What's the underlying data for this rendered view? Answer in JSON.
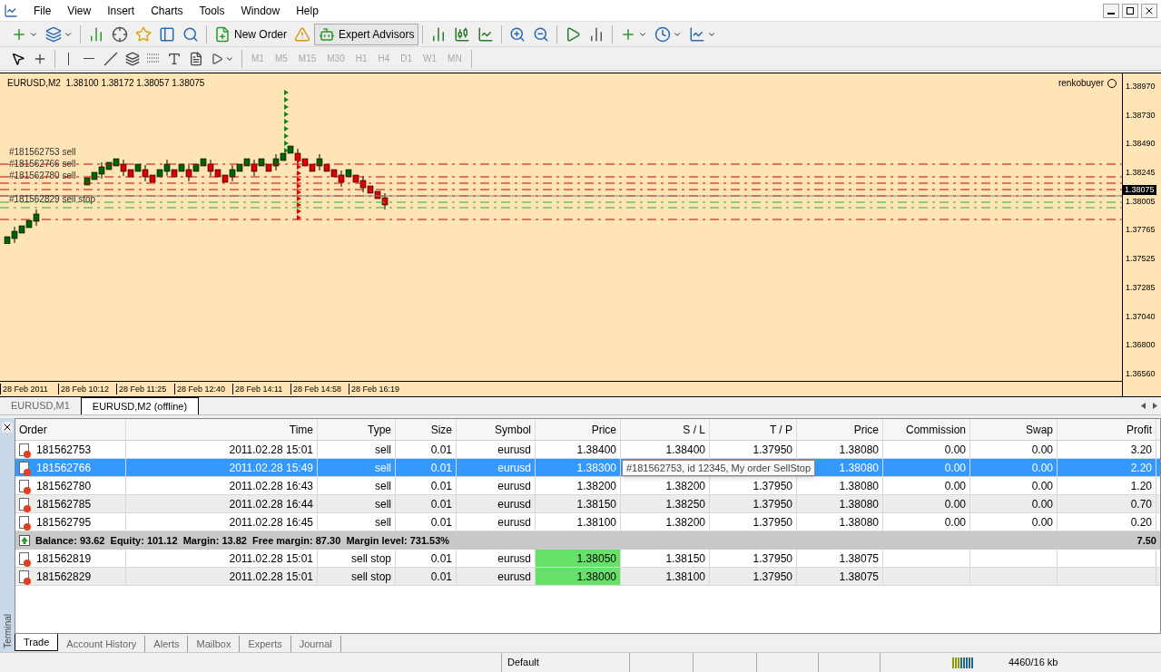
{
  "menu": [
    "File",
    "View",
    "Insert",
    "Charts",
    "Tools",
    "Window",
    "Help"
  ],
  "toolbar": {
    "new_order": "New Order",
    "expert_advisors": "Expert Advisors",
    "experts_on": true
  },
  "timeframes": [
    {
      "label": "M1",
      "disabled": true
    },
    {
      "label": "M5",
      "disabled": true
    },
    {
      "label": "M15",
      "disabled": true
    },
    {
      "label": "M30",
      "disabled": true
    },
    {
      "label": "H1",
      "disabled": true
    },
    {
      "label": "H4",
      "disabled": true
    },
    {
      "label": "D1",
      "disabled": true
    },
    {
      "label": "W1",
      "disabled": true
    },
    {
      "label": "MN",
      "disabled": true
    }
  ],
  "chart": {
    "header": "EURUSD,M2  1.38100 1.38172 1.38057 1.38075",
    "user": "renkobuyer",
    "price_ticks": [
      "1.38970",
      "1.38730",
      "1.38490",
      "1.38245",
      "1.38005",
      "1.37765",
      "1.37525",
      "1.37285",
      "1.37040",
      "1.36800",
      "1.36560"
    ],
    "current_price": "1.38075",
    "time_ticks": [
      "28 Feb 2011",
      "28 Feb 10:12",
      "28 Feb 11:25",
      "28 Feb 12:40",
      "28 Feb 14:11",
      "28 Feb 14:58",
      "28 Feb 16:19"
    ],
    "order_labels": [
      "#181562753 sell",
      "#181562766 sell",
      "#181562780 sell",
      "#181562829 sell stop"
    ]
  },
  "chart_tabs": [
    {
      "label": "EURUSD,M1",
      "selected": false
    },
    {
      "label": "EURUSD,M2 (offline)",
      "selected": true
    }
  ],
  "terminal": {
    "side_label": "Terminal",
    "columns": [
      "Order",
      "Time",
      "Type",
      "Size",
      "Symbol",
      "Price",
      "S / L",
      "T / P",
      "Price",
      "Commission",
      "Swap",
      "Profit"
    ],
    "rows": [
      {
        "kind": "order",
        "selected": false,
        "pending": false,
        "cells": [
          "181562753",
          "2011.02.28 15:01",
          "sell",
          "0.01",
          "eurusd",
          "1.38400",
          "1.38400",
          "1.37950",
          "1.38080",
          "0.00",
          "0.00",
          "3.20"
        ]
      },
      {
        "kind": "order",
        "selected": true,
        "pending": false,
        "cells": [
          "181562766",
          "2011.02.28 15:49",
          "sell",
          "0.01",
          "eurusd",
          "1.38300",
          null,
          null,
          "1.38080",
          "0.00",
          "0.00",
          "2.20"
        ]
      },
      {
        "kind": "order",
        "selected": false,
        "pending": false,
        "cells": [
          "181562780",
          "2011.02.28 16:43",
          "sell",
          "0.01",
          "eurusd",
          "1.38200",
          "1.38200",
          "1.37950",
          "1.38080",
          "0.00",
          "0.00",
          "1.20"
        ]
      },
      {
        "kind": "order",
        "selected": false,
        "pending": false,
        "cells": [
          "181562785",
          "2011.02.28 16:44",
          "sell",
          "0.01",
          "eurusd",
          "1.38150",
          "1.38250",
          "1.37950",
          "1.38080",
          "0.00",
          "0.00",
          "0.70"
        ]
      },
      {
        "kind": "order",
        "selected": false,
        "pending": false,
        "cells": [
          "181562795",
          "2011.02.28 16:45",
          "sell",
          "0.01",
          "eurusd",
          "1.38100",
          "1.38200",
          "1.37950",
          "1.38080",
          "0.00",
          "0.00",
          "0.20"
        ]
      },
      {
        "kind": "summary",
        "text": "Balance: 93.62  Equity: 101.12  Margin: 13.82  Free margin: 87.30  Margin level: 731.53%",
        "total": "7.50"
      },
      {
        "kind": "order",
        "selected": false,
        "pending": true,
        "cells": [
          "181562819",
          "2011.02.28 15:01",
          "sell stop",
          "0.01",
          "eurusd",
          "1.38050",
          "1.38150",
          "1.37950",
          "1.38075",
          null,
          null,
          null
        ]
      },
      {
        "kind": "order",
        "selected": false,
        "pending": true,
        "cells": [
          "181562829",
          "2011.02.28 15:01",
          "sell stop",
          "0.01",
          "eurusd",
          "1.38000",
          "1.38100",
          "1.37950",
          "1.38075",
          null,
          null,
          null
        ]
      }
    ],
    "tooltip": "#181562753, id 12345, My order SellStop",
    "tabs": [
      {
        "label": "Trade",
        "selected": true
      },
      {
        "label": "Account History",
        "selected": false
      },
      {
        "label": "Alerts",
        "selected": false
      },
      {
        "label": "Mailbox",
        "selected": false
      },
      {
        "label": "Experts",
        "selected": false
      },
      {
        "label": "Journal",
        "selected": false
      }
    ]
  },
  "status_bar": {
    "profile": "Default",
    "traffic": "4460/16 kb"
  }
}
